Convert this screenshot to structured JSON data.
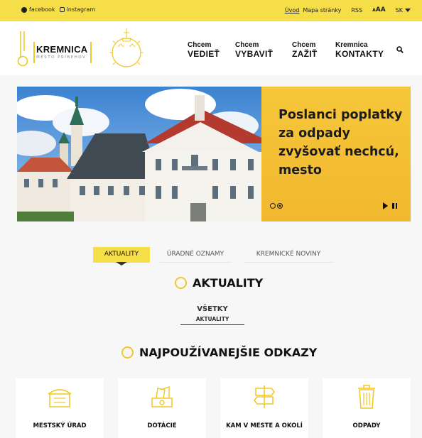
{
  "topbar": {
    "social": [
      {
        "label": "facebook",
        "icon": "facebook-icon"
      },
      {
        "label": "instagram",
        "icon": "instagram-icon"
      }
    ],
    "links": [
      "Úvod",
      "Mapa stránky",
      "RSS"
    ],
    "font_size_label": "AA",
    "font_size_small": "A",
    "language": "SK"
  },
  "header": {
    "logo_name": "KREMNICA",
    "logo_tagline": "MESTO PRÍBEHOV",
    "nav": [
      {
        "line1": "Chcem",
        "line2": "VEDIEŤ"
      },
      {
        "line1": "Chcem",
        "line2": "VYBAVIŤ"
      },
      {
        "line1": "Chcem",
        "line2": "ZAŽIŤ"
      },
      {
        "line1": "Kremnica",
        "line2": "KONTAKTY"
      }
    ]
  },
  "hero": {
    "headline": "Poslanci poplatky za odpady zvyšovať nechcú, mesto",
    "slide_count": 2,
    "active_slide": 2
  },
  "tabs": [
    {
      "label": "AKTUALITY",
      "active": true
    },
    {
      "label": "ÚRADNÉ OZNAMY",
      "active": false
    },
    {
      "label": "KREMNICKÉ NOVINY",
      "active": false
    }
  ],
  "news": {
    "title": "AKTUALITY",
    "filter_all": "VŠETKY",
    "filter_sub": "AKTUALITY"
  },
  "links_section": {
    "title": "NAJPOUŽÍVANEJŠIE ODKAZY",
    "cards": [
      {
        "label": "MESTSKÝ ÚRAD",
        "icon": "town-hall-icon"
      },
      {
        "label": "DOTÁCIE",
        "icon": "money-icon"
      },
      {
        "label": "KAM V MESTE A OKOLÍ",
        "icon": "signpost-icon"
      },
      {
        "label": "ODPADY",
        "icon": "trash-bin-icon"
      }
    ]
  },
  "colors": {
    "accent": "#f6de49",
    "panel": "#f3bf34"
  }
}
